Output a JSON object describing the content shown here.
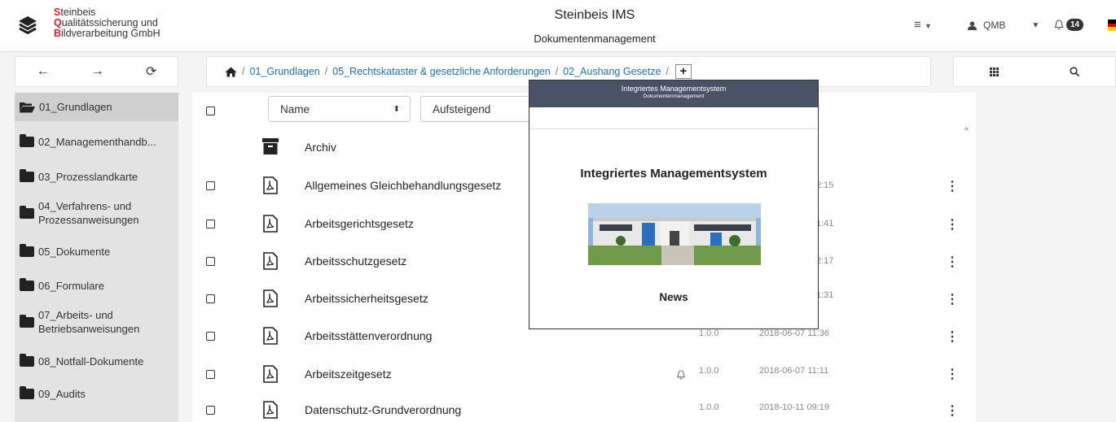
{
  "header": {
    "logo_line1_cap": "S",
    "logo_line1_rest": "teinbeis",
    "logo_line2_cap": "Q",
    "logo_line2_rest": "ualitätssicherung und",
    "logo_line3_cap": "B",
    "logo_line3_rest": "ildverarbeitung GmbH",
    "title": "Steinbeis IMS",
    "subtitle": "Dokumentenmanagement",
    "menu_icon": "hamburger-icon",
    "user_label": "QMB",
    "notification_count": "14",
    "flag_colors": [
      "#000000",
      "#dd0000",
      "#ffce00"
    ]
  },
  "nav": {
    "back": "←",
    "forward": "→",
    "refresh": "⟳"
  },
  "breadcrumb": {
    "items": [
      "01_Grundlagen",
      "05_Rechtskataster & gesetzliche Anforderungen",
      "02_Aushang Gesetze"
    ],
    "separator": "/",
    "add": "+"
  },
  "right_bar": {
    "grid_icon": "grid-icon",
    "search_icon": "search-icon"
  },
  "sidebar": {
    "items": [
      {
        "label": "01_Grundlagen",
        "label2": ""
      },
      {
        "label": "02_Managementhandb...",
        "label2": ""
      },
      {
        "label": "03_Prozesslandkarte",
        "label2": ""
      },
      {
        "label": "04_Verfahrens- und",
        "label2": "Prozessanweisungen"
      },
      {
        "label": "05_Dokumente",
        "label2": ""
      },
      {
        "label": "06_Formulare",
        "label2": ""
      },
      {
        "label": "07_Arbeits- und",
        "label2": "Betriebsanweisungen"
      },
      {
        "label": "08_Notfall-Dokumente",
        "label2": ""
      },
      {
        "label": "09_Audits",
        "label2": ""
      }
    ]
  },
  "list": {
    "sort_field": "Name",
    "sort_order": "Aufsteigend",
    "archive_label": "Archiv",
    "rows": [
      {
        "name": "Allgemeines Gleichbehandlungsgesetz",
        "version": "",
        "date": "2:15"
      },
      {
        "name": "Arbeitsgerichtsgesetz",
        "version": "",
        "date": "1:41"
      },
      {
        "name": "Arbeitsschutzgesetz",
        "version": "",
        "date": "2:17"
      },
      {
        "name": "Arbeitssicherheitsgesetz",
        "version": "",
        "date": "1:31"
      },
      {
        "name": "Arbeitsstättenverordnung",
        "version": "1.0.0",
        "date": "2018-06-07 11:36"
      },
      {
        "name": "Arbeitszeitgesetz",
        "version": "1.0.0",
        "date": "2018-06-07 11:11"
      },
      {
        "name": "Datenschutz-Grundverordnung",
        "version": "1.0.0",
        "date": "2018-10-11 09:19"
      }
    ]
  },
  "preview": {
    "header_title": "Integriertes Managementsystem",
    "header_subtitle": "Dokumentenmanagement",
    "title": "Integriertes Managementsystem",
    "news": "News"
  }
}
